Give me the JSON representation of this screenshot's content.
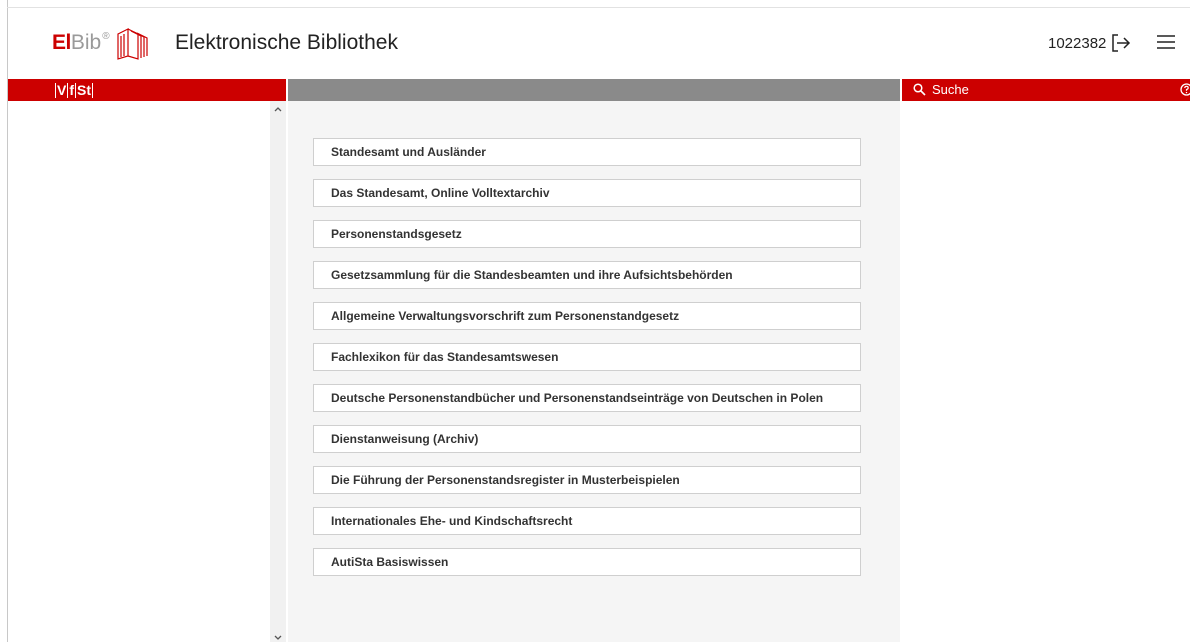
{
  "header": {
    "logo_el": "El",
    "logo_bib": "Bib",
    "logo_reg": "®",
    "title": "Elektronische Bibliothek",
    "user_id": "1022382",
    "logout_icon": "logout-arrow-icon",
    "menu_icon": "hamburger-menu-icon"
  },
  "left_bar": {
    "letters": [
      "V",
      "f",
      "St"
    ]
  },
  "search_bar": {
    "label": "Suche",
    "search_icon": "search-icon",
    "help_icon": "help-circle-icon"
  },
  "books": [
    "Standesamt und Ausländer",
    "Das Standesamt, Online Volltextarchiv",
    "Personenstandsgesetz",
    "Gesetzsammlung für die Standesbeamten und ihre Aufsichtsbehörden",
    "Allgemeine Verwaltungsvorschrift zum Personenstandgesetz",
    "Fachlexikon für das Standesamtswesen",
    "Deutsche Personenstandbücher und Personenstandseinträge von Deutschen in Polen",
    "Dienstanweisung (Archiv)",
    "Die Führung der Personenstandsregister in Musterbeispielen",
    "Internationales Ehe- und Kindschaftsrecht",
    "AutiSta Basiswissen"
  ],
  "colors": {
    "brand_red": "#cc0000",
    "gray_bar": "#8a8a8a",
    "content_bg": "#f5f5f5"
  }
}
